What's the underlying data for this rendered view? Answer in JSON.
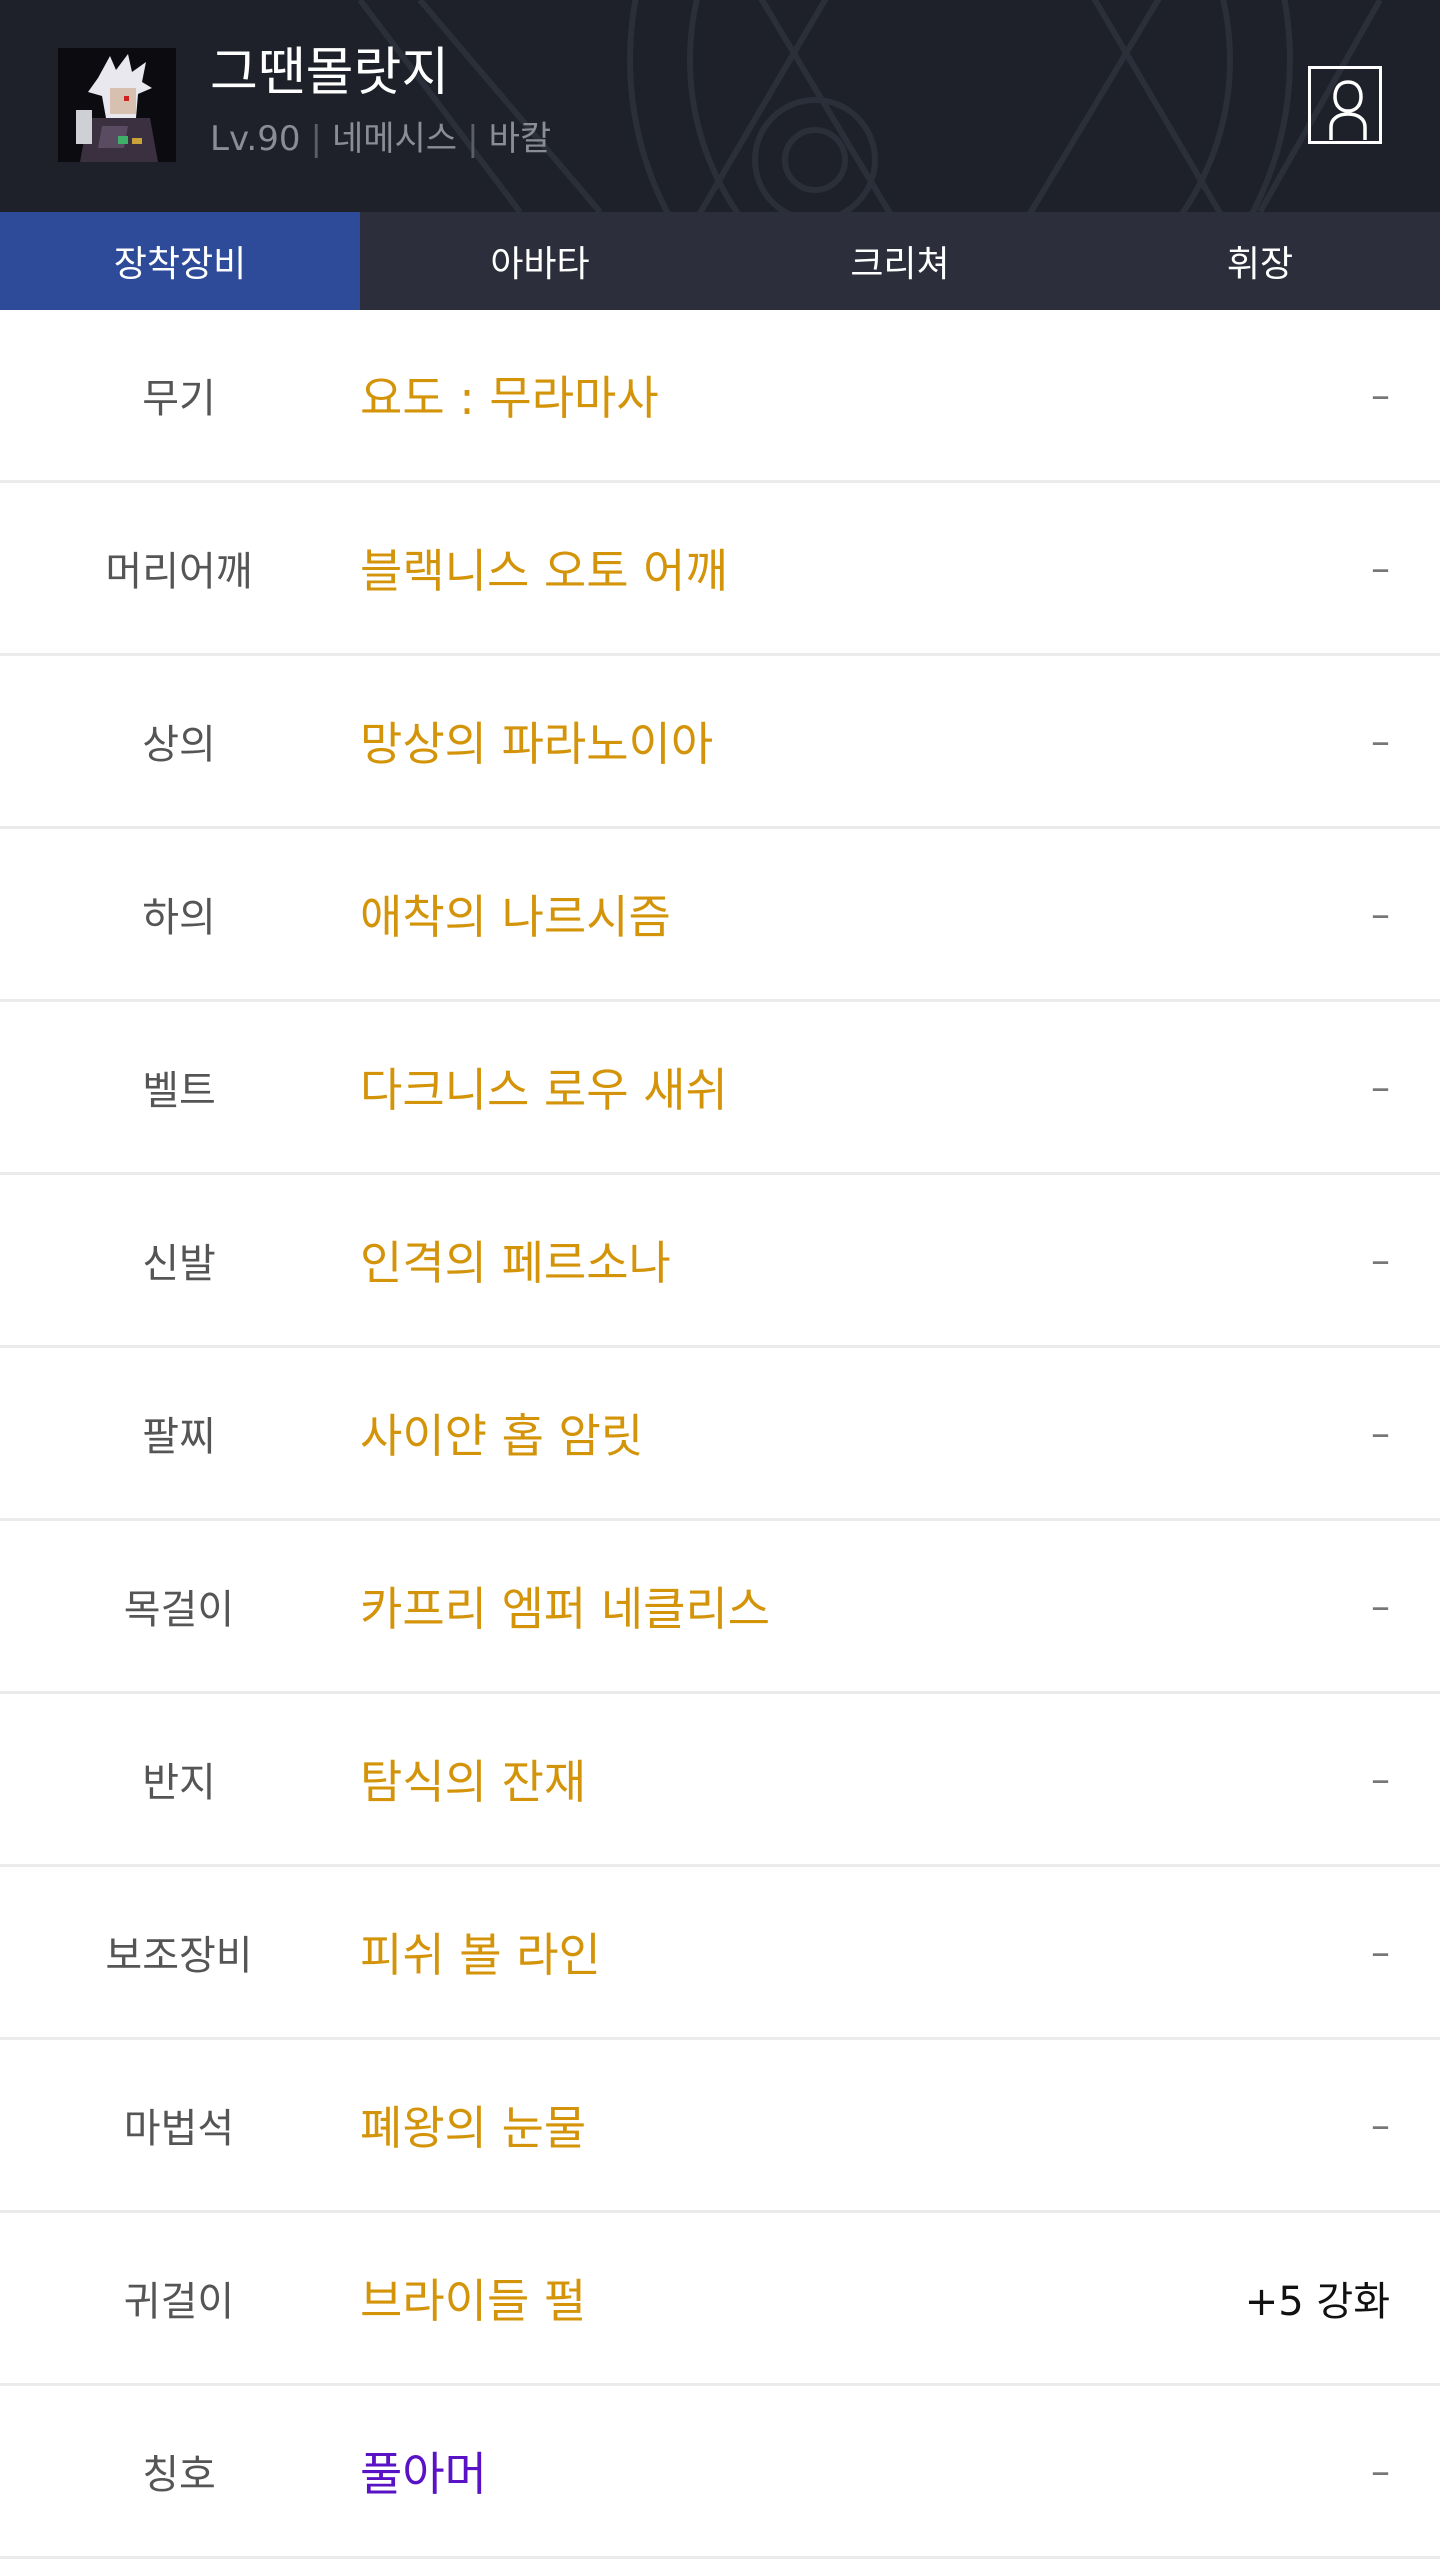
{
  "header": {
    "character_name": "그땐몰랏지",
    "level": "Lv.90",
    "job": "네메시스",
    "server": "바칼",
    "separator": "|",
    "avatar_icon": "character-portrait-icon",
    "profile_icon": "user-profile-icon"
  },
  "tabs": [
    {
      "label": "장착장비",
      "active": true
    },
    {
      "label": "아바타",
      "active": false
    },
    {
      "label": "크리쳐",
      "active": false
    },
    {
      "label": "휘장",
      "active": false
    }
  ],
  "colors": {
    "item_gold": "#d4940a",
    "item_purple": "#5a12c6",
    "tab_active": "#2e4b9a",
    "tab_bar": "#2c2f3b",
    "header_bg": "#1e2129"
  },
  "equipment": [
    {
      "slot": "무기",
      "item": "요도 : 무라마사",
      "extra": "–"
    },
    {
      "slot": "머리어깨",
      "item": "블랙니스 오토 어깨",
      "extra": "–"
    },
    {
      "slot": "상의",
      "item": "망상의 파라노이아",
      "extra": "–"
    },
    {
      "slot": "하의",
      "item": "애착의 나르시즘",
      "extra": "–"
    },
    {
      "slot": "벨트",
      "item": "다크니스 로우 새쉬",
      "extra": "–"
    },
    {
      "slot": "신발",
      "item": "인격의 페르소나",
      "extra": "–"
    },
    {
      "slot": "팔찌",
      "item": "사이얀 홉 암릿",
      "extra": "–"
    },
    {
      "slot": "목걸이",
      "item": "카프리 엠퍼 네클리스",
      "extra": "–"
    },
    {
      "slot": "반지",
      "item": "탐식의 잔재",
      "extra": "–"
    },
    {
      "slot": "보조장비",
      "item": "피쉬 볼 라인",
      "extra": "–"
    },
    {
      "slot": "마법석",
      "item": "폐왕의 눈물",
      "extra": "–"
    },
    {
      "slot": "귀걸이",
      "item": "브라이들 펄",
      "extra": "+5 강화"
    },
    {
      "slot": "칭호",
      "item": "풀아머",
      "extra": "–"
    }
  ]
}
